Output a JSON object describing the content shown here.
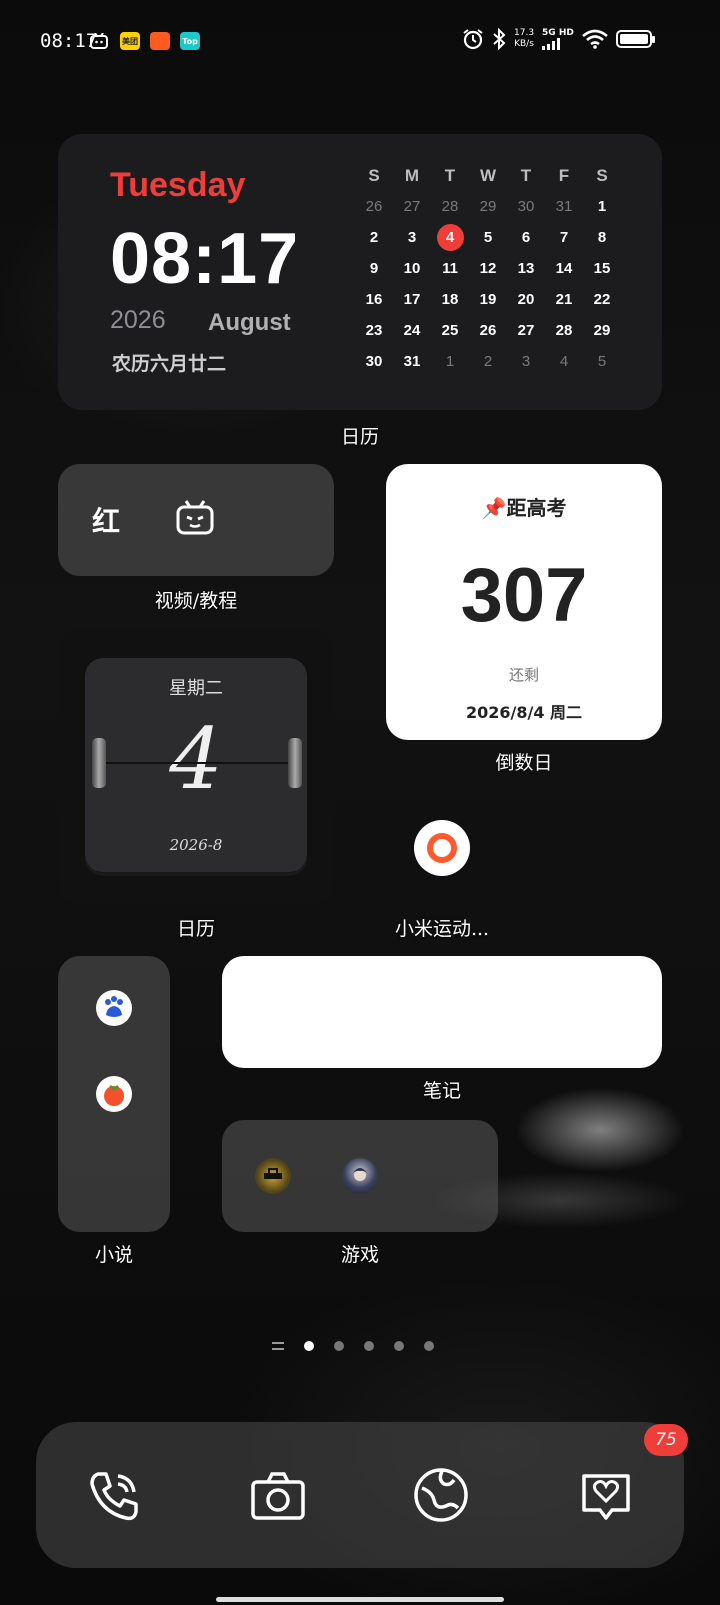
{
  "status_bar": {
    "time": "08:17",
    "notif_icons": [
      "bilibili-icon",
      "meituan-icon",
      "taobao-icon",
      "top-icon"
    ],
    "meituan_label": "美团",
    "top_label": "Top",
    "speed": "17.3",
    "speed_unit": "KB/s",
    "network": "5G HD"
  },
  "calendar_widget": {
    "weekday": "Tuesday",
    "time": "08:17",
    "year": "2026",
    "month": "August",
    "lunar": "农历六月廿二",
    "headers": [
      "S",
      "M",
      "T",
      "W",
      "T",
      "F",
      "S"
    ],
    "weeks": [
      [
        "26",
        "27",
        "28",
        "29",
        "30",
        "31",
        "1"
      ],
      [
        "2",
        "3",
        "4",
        "5",
        "6",
        "7",
        "8"
      ],
      [
        "9",
        "10",
        "11",
        "12",
        "13",
        "14",
        "15"
      ],
      [
        "16",
        "17",
        "18",
        "19",
        "20",
        "21",
        "22"
      ],
      [
        "23",
        "24",
        "25",
        "26",
        "27",
        "28",
        "29"
      ],
      [
        "30",
        "31",
        "1",
        "2",
        "3",
        "4",
        "5"
      ]
    ],
    "today": "4",
    "label": "日历"
  },
  "video_folder": {
    "items": [
      "红",
      "bilibili-icon"
    ],
    "label": "视频/教程"
  },
  "countdown": {
    "title": "📌距高考",
    "days": "307",
    "remaining": "还剩",
    "date": "2026/8/4 周二",
    "label": "倒数日"
  },
  "flip_calendar": {
    "weekday": "星期二",
    "day": "4",
    "year_month": "2026-8",
    "label": "日历"
  },
  "mi_fitness": {
    "label": "小米运动..."
  },
  "novel_folder": {
    "label": "小说",
    "apps": [
      "baidu-icon",
      "fanqie-icon"
    ]
  },
  "notes": {
    "label": "笔记"
  },
  "games_folder": {
    "label": "游戏",
    "apps": [
      "call-of-duty-icon",
      "anime-game-icon"
    ]
  },
  "pager": {
    "count": 5,
    "active": 0
  },
  "dock": {
    "apps": [
      "phone-icon",
      "camera-icon",
      "browser-icon",
      "themes-icon"
    ],
    "badge": "75"
  },
  "colors": {
    "accent_red": "#ef3e3a",
    "widget_bg": "#1c1c1e"
  }
}
